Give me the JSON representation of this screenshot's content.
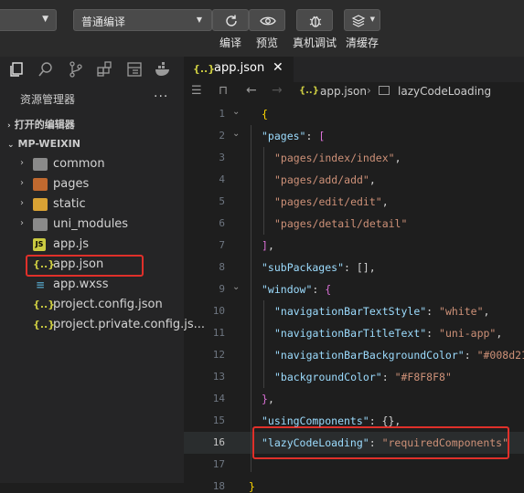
{
  "toolbar": {
    "compile_mode": "普通编译",
    "compile_label": "编译",
    "preview_label": "预览",
    "debug_label": "真机调试",
    "clear_cache_label": "清缓存"
  },
  "sidebar": {
    "title": "资源管理器",
    "more": "···",
    "open_editors": "打开的编辑器",
    "project_name": "MP-WEIXIN",
    "items": [
      {
        "label": "common",
        "type": "folder"
      },
      {
        "label": "pages",
        "type": "folder"
      },
      {
        "label": "static",
        "type": "folder"
      },
      {
        "label": "uni_modules",
        "type": "folder"
      },
      {
        "label": "app.js",
        "type": "js"
      },
      {
        "label": "app.json",
        "type": "json"
      },
      {
        "label": "app.wxss",
        "type": "css"
      },
      {
        "label": "project.config.json",
        "type": "json"
      },
      {
        "label": "project.private.config.js...",
        "type": "json"
      }
    ]
  },
  "editor": {
    "tab_label": "app.json",
    "breadcrumb_file": "app.json",
    "breadcrumb_symbol": "lazyCodeLoading",
    "active_line": 16,
    "lines": [
      {
        "n": "1",
        "text": "{"
      },
      {
        "n": "2",
        "key": "\"pages\"",
        "after": ": ["
      },
      {
        "n": "3",
        "str": "\"pages/index/index\"",
        "after": ","
      },
      {
        "n": "4",
        "str": "\"pages/add/add\"",
        "after": ","
      },
      {
        "n": "5",
        "str": "\"pages/edit/edit\"",
        "after": ","
      },
      {
        "n": "6",
        "str": "\"pages/detail/detail\""
      },
      {
        "n": "7",
        "text": "],"
      },
      {
        "n": "8",
        "key": "\"subPackages\"",
        "after": ": [],"
      },
      {
        "n": "9",
        "key": "\"window\"",
        "after": ": {"
      },
      {
        "n": "10",
        "key": "\"navigationBarTextStyle\"",
        "mid": ": ",
        "str": "\"white\"",
        "after": ","
      },
      {
        "n": "11",
        "key": "\"navigationBarTitleText\"",
        "mid": ": ",
        "str": "\"uni-app\"",
        "after": ","
      },
      {
        "n": "12",
        "key": "\"navigationBarBackgroundColor\"",
        "mid": ": ",
        "str": "\"#008d21\"",
        "after": ","
      },
      {
        "n": "13",
        "key": "\"backgroundColor\"",
        "mid": ": ",
        "str": "\"#F8F8F8\""
      },
      {
        "n": "14",
        "text": "},"
      },
      {
        "n": "15",
        "key": "\"usingComponents\"",
        "after": ": {},"
      },
      {
        "n": "16",
        "key": "\"lazyCodeLoading\"",
        "mid": ": ",
        "str": "\"requiredComponents\""
      },
      {
        "n": "17",
        "text": ""
      },
      {
        "n": "18",
        "text": "}"
      }
    ]
  },
  "colors": {
    "highlight_box": "#e0302a",
    "json_key": "#9cdcfe",
    "json_string": "#ce9178"
  }
}
